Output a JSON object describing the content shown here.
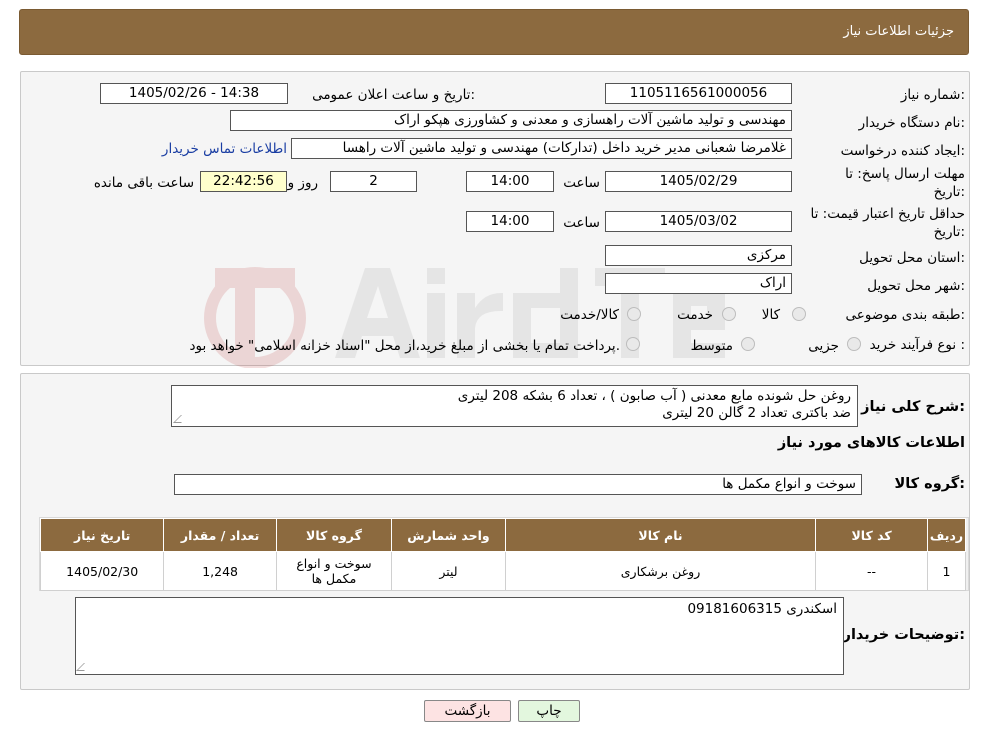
{
  "header": {
    "title": "جزئیات اطلاعات نیاز"
  },
  "form": {
    "need_number_label": "شماره نیاز:",
    "need_number": "1105116561000056",
    "announce_label": "تاریخ و ساعت اعلان عمومی:",
    "announce_value": "1405/02/26 - 14:38",
    "buyer_org_label": "نام دستگاه خریدار:",
    "buyer_org": "مهندسی و تولید ماشین آلات راهسازی و معدنی و کشاورزی هپکو اراک",
    "creator_label": "ایجاد کننده درخواست:",
    "creator": "غلامرضا شعبانی مدیر خرید داخل (تدارکات) مهندسی و تولید ماشین آلات راهسا",
    "contact_link": "اطلاعات تماس خریدار",
    "deadline_label_1": "مهلت ارسال پاسخ: تا",
    "deadline_label_2": "تاریخ:",
    "deadline_date": "1405/02/29",
    "time_label": "ساعت",
    "deadline_time": "14:00",
    "days_value": "2",
    "days_label": "روز و",
    "remaining_time": "22:42:56",
    "remaining_label": "ساعت باقی مانده",
    "validity_label_1": "حداقل تاریخ اعتبار قیمت: تا",
    "validity_label_2": "تاریخ:",
    "validity_date": "1405/03/02",
    "validity_time": "14:00",
    "province_label": "استان محل تحویل:",
    "province": "مرکزی",
    "city_label": "شهر محل تحویل:",
    "city": "اراک",
    "category_label": "طبقه بندی موضوعی:",
    "category_options": [
      "کالا",
      "خدمت",
      "کالا/خدمت"
    ],
    "process_label": "نوع فرآیند خرید :",
    "process_options": [
      "جزیی",
      "متوسط"
    ],
    "process_note": "پرداخت تمام یا بخشی از مبلغ خرید،از محل \"اسناد خزانه اسلامی\" خواهد بود."
  },
  "summary": {
    "label": "شرح کلی نیاز:",
    "line1": "روغن حل شونده مایع معدنی ( آب صابون ) ، تعداد 6 بشکه 208 لیتری",
    "line2": "ضد باکتری تعداد 2 گالن 20 لیتری",
    "items_title": "اطلاعات کالاهای مورد نیاز",
    "group_label": "گروه کالا:",
    "group_value": "سوخت و انواع مکمل ها"
  },
  "table": {
    "headers": [
      "ردیف",
      "کد کالا",
      "نام کالا",
      "واحد شمارش",
      "گروه کالا",
      "تعداد / مقدار",
      "تاریخ نیاز"
    ],
    "rows": [
      [
        "1",
        "--",
        "روغن برشکاری",
        "لیتر",
        "سوخت و انواع مکمل ها",
        "1,248",
        "1405/02/30"
      ]
    ]
  },
  "buyer_notes": {
    "label": "توضیحات خریدار:",
    "text": "اسکندری 09181606315"
  },
  "buttons": {
    "print": "چاپ",
    "back": "بازگشت"
  },
  "colors": {
    "header_bg": "#8c6a3f",
    "link": "#1a3ea3",
    "back_btn_bg": "#fde3e3",
    "print_btn_bg": "#e3f7de"
  }
}
